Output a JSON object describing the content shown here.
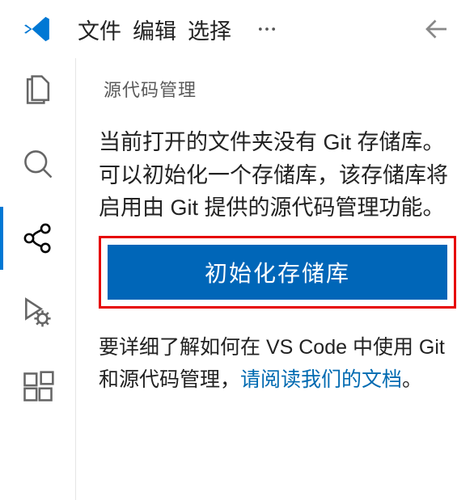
{
  "menu": {
    "file": "文件",
    "edit": "编辑",
    "select": "选择"
  },
  "panel": {
    "title": "源代码管理",
    "description": "当前打开的文件夹没有 Git 存储库。可以初始化一个存储库，该存储库将启用由 Git 提供的源代码管理功能。",
    "init_button": "初始化存储库",
    "learn_prefix": "要详细了解如何在 VS Code 中使用 Git 和源代码管理，",
    "learn_link": "请阅读我们的文档",
    "learn_suffix": "。"
  },
  "colors": {
    "accent": "#0078d4",
    "button": "#0066b8",
    "highlight_border": "#e60000",
    "link": "#006ab1"
  }
}
